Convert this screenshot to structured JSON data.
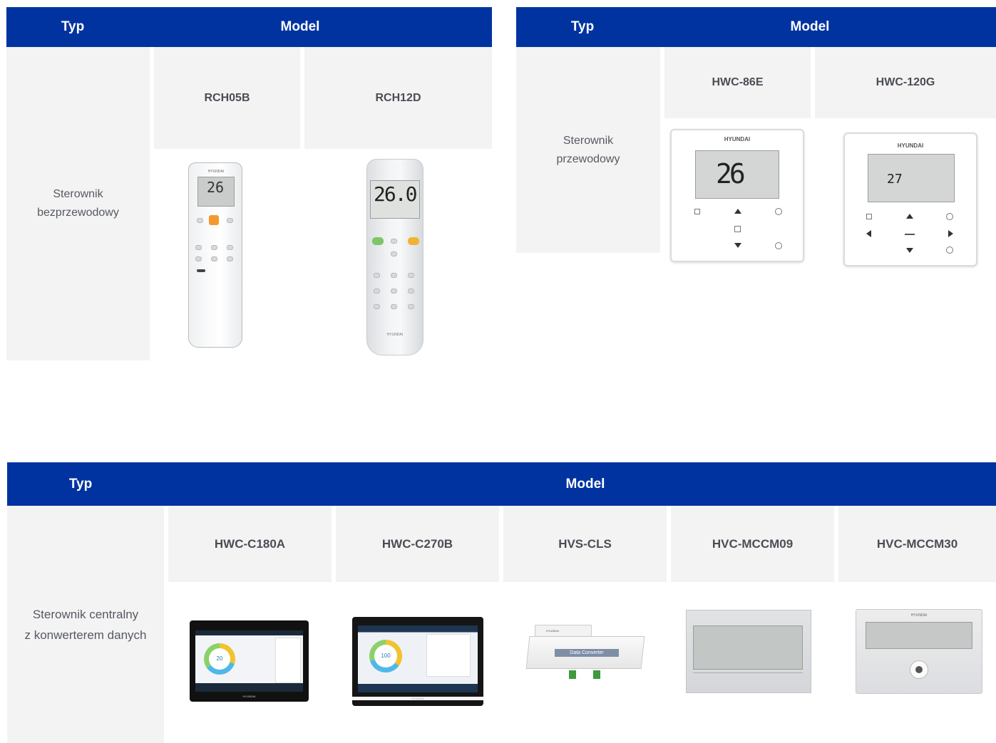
{
  "tables": [
    {
      "header": {
        "type_label": "Typ",
        "model_label": "Model"
      },
      "type": "Sterownik\nbezprzewodowy",
      "models": [
        "RCH05B",
        "RCH12D"
      ]
    },
    {
      "header": {
        "type_label": "Typ",
        "model_label": "Model"
      },
      "type": "Sterownik\nprzewodowy",
      "models": [
        "HWC-86E",
        "HWC-120G"
      ]
    },
    {
      "header": {
        "type_label": "Typ",
        "model_label": "Model"
      },
      "type": "Sterownik centralny\nz konwerterem danych",
      "models": [
        "HWC-C180A",
        "HWC-C270B",
        "HVS-CLS",
        "HVC-MCCM09",
        "HVC-MCCM30"
      ]
    }
  ],
  "product_text": {
    "brand": "HYUNDAI",
    "rch05b_temp": "26",
    "rch12d_temp": "26.0",
    "hwc86e_temp": "26",
    "hwc120g_temp": "27",
    "c180a_value": "20",
    "c270b_value": "100",
    "converter_label": "Data Converter"
  },
  "colors": {
    "header_bg": "#0033a0",
    "cell_bg": "#f3f3f4"
  }
}
